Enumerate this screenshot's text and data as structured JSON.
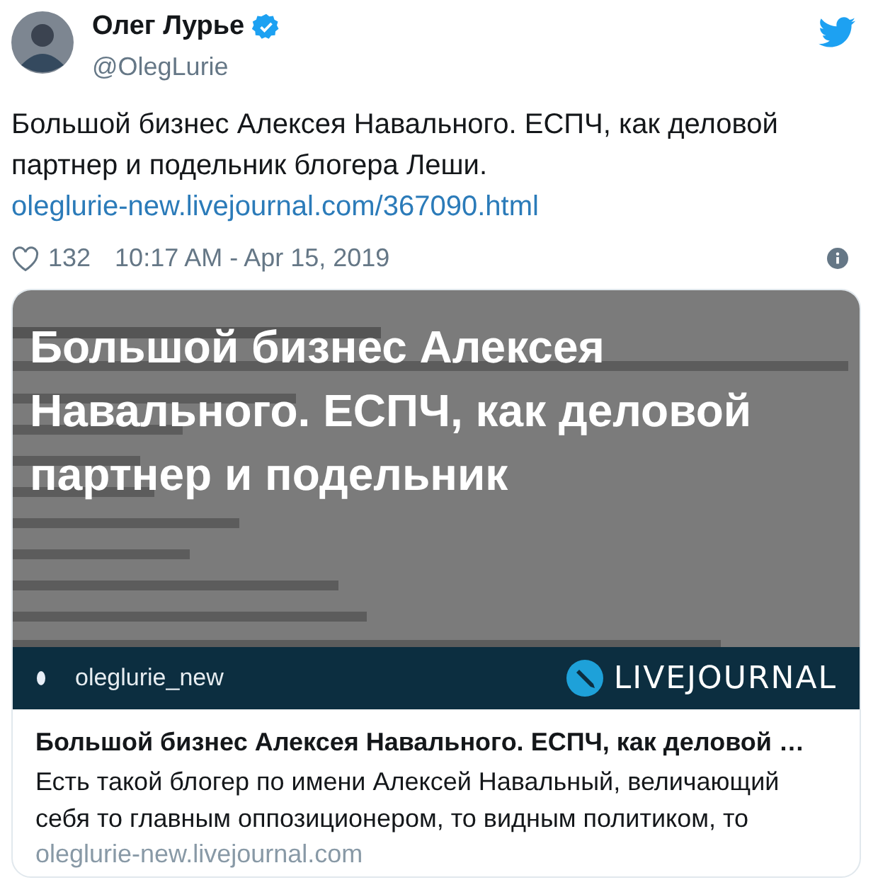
{
  "author": {
    "name": "Олег Лурье",
    "verified": true,
    "handle": "@OlegLurie"
  },
  "tweet": {
    "text": "Большой бизнес Алексея Навального. ЕСПЧ, как деловой партнер и подельник блогера Леши.",
    "link": "oleglurie-new.livejournal.com/367090.html"
  },
  "meta": {
    "likes": "132",
    "time": "10:17 AM - Apr 15, 2019"
  },
  "card": {
    "image": {
      "headline": "Большой бизнес Алексея Навального. ЕСПЧ, как деловой партнер и подельник"
    },
    "bar": {
      "blog": "oleglurie_new",
      "brand": "LIVEJOURNAL"
    },
    "title": "Большой бизнес Алексея Навального. ЕСПЧ, как деловой …",
    "description": "Есть такой блогер по имени Алексей Навальный, величающий себя то главным оппозиционером, то видным политиком, то",
    "domain": "oleglurie-new.livejournal.com"
  }
}
